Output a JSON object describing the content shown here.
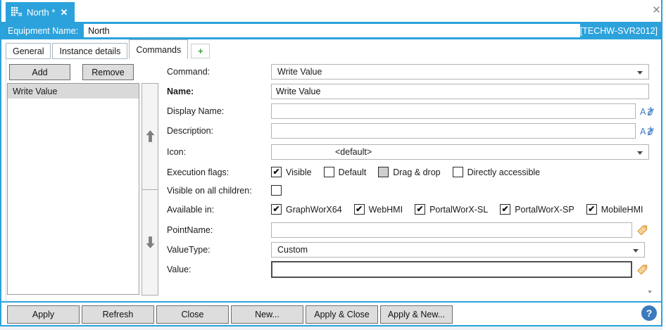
{
  "colors": {
    "accent_blue": "#2CA2DC",
    "help_blue": "#3A7ABD",
    "tag_orange": "#E8A33C",
    "localize_blue": "#3B79C3",
    "plus_green": "#3F9E3F"
  },
  "window": {
    "close_glyph": "✕"
  },
  "doc_tab": {
    "title": "North *",
    "close_glyph": "✕"
  },
  "header": {
    "label": "Equipment Name:",
    "value": "North",
    "server": "[TECHW-SVR2012]"
  },
  "tab_strip": {
    "tabs": [
      {
        "label": "General"
      },
      {
        "label": "Instance details"
      },
      {
        "label": "Commands"
      }
    ],
    "add_tab_glyph": "+"
  },
  "commands_panel": {
    "add_button": "Add",
    "remove_button": "Remove",
    "list": {
      "items": [
        {
          "label": "Write Value",
          "selected": true
        }
      ]
    }
  },
  "form": {
    "command": {
      "label": "Command:",
      "value": "Write Value"
    },
    "name": {
      "label": "Name:",
      "value": "Write Value"
    },
    "display_name": {
      "label": "Display Name:",
      "value": "",
      "localize_glyph": "Aあ"
    },
    "description": {
      "label": "Description:",
      "value": "",
      "localize_glyph": "Aあ"
    },
    "icon": {
      "label": "Icon:",
      "value": "<default>"
    },
    "execution_flags": {
      "label": "Execution flags:",
      "options": [
        {
          "label": "Visible",
          "state": "checked"
        },
        {
          "label": "Default",
          "state": "unchecked"
        },
        {
          "label": "Drag & drop",
          "state": "indeterminate"
        },
        {
          "label": "Directly accessible",
          "state": "unchecked"
        }
      ]
    },
    "visible_on_all_children": {
      "label": "Visible on all children:",
      "state": "unchecked"
    },
    "available_in": {
      "label": "Available in:",
      "options": [
        {
          "label": "GraphWorX64",
          "state": "checked"
        },
        {
          "label": "WebHMI",
          "state": "checked"
        },
        {
          "label": "PortalWorX-SL",
          "state": "checked"
        },
        {
          "label": "PortalWorX-SP",
          "state": "checked"
        },
        {
          "label": "MobileHMI",
          "state": "checked"
        }
      ]
    },
    "point_name": {
      "label": "PointName:",
      "value": ""
    },
    "value_type": {
      "label": "ValueType:",
      "value": "Custom"
    },
    "value": {
      "label": "Value:",
      "value": ""
    }
  },
  "footer": {
    "buttons": [
      "Apply",
      "Refresh",
      "Close",
      "New...",
      "Apply & Close",
      "Apply & New..."
    ],
    "help_glyph": "?"
  }
}
